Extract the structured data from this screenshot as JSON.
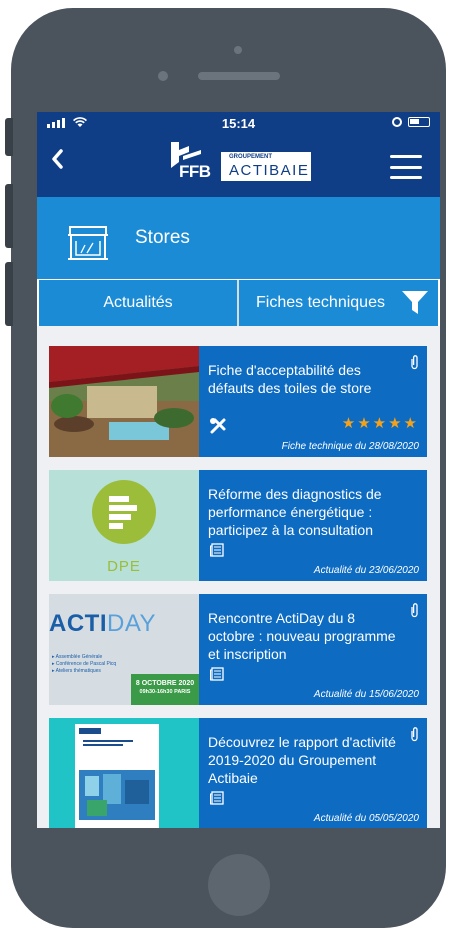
{
  "status_bar": {
    "time": "15:14"
  },
  "header": {
    "logo_ffb": "FFB",
    "logo_groupement": "GROUPEMENT",
    "logo_actibaie": "ACTIBAIE"
  },
  "category": {
    "title": "Stores",
    "icon": "awning-icon"
  },
  "tabs": [
    {
      "label": "Actualités"
    },
    {
      "label": "Fiches techniques"
    }
  ],
  "cards": [
    {
      "title": "Fiche d'acceptabilité des défauts des toiles de store",
      "meta": "Fiche technique du 28/08/2020",
      "rating": "★★★★★",
      "icon": "tools-icon",
      "attachment": true
    },
    {
      "title": "Réforme des diagnostics de performance énergétique : participez à la consultation",
      "meta": "Actualité du 23/06/2020",
      "thumb_label": "DPE",
      "icon": "newspaper-icon",
      "attachment": false
    },
    {
      "title": "Rencontre ActiDay du 8 octobre : nouveau programme et inscription",
      "meta": "Actualité du 15/06/2020",
      "thumb_title_a": "ACTI",
      "thumb_title_b": "DAY",
      "thumb_lines": [
        "▸ Assemblée Générale",
        "▸ Conférence de Pascal Picq",
        "▸ Ateliers thématiques"
      ],
      "thumb_date": "8 OCTOBRE 2020",
      "thumb_time": "09h30-16h30 PARIS",
      "icon": "newspaper-icon",
      "attachment": true
    },
    {
      "title": "Découvrez le rapport d'activité 2019-2020 du Groupement Actibaie",
      "meta": "Actualité du 05/05/2020",
      "icon": "newspaper-icon",
      "attachment": true
    }
  ],
  "colors": {
    "header_navy": "#0f3d86",
    "category_blue": "#1b8bd5",
    "card_blue": "#0d6bc2",
    "star_orange": "#f4a21c"
  }
}
